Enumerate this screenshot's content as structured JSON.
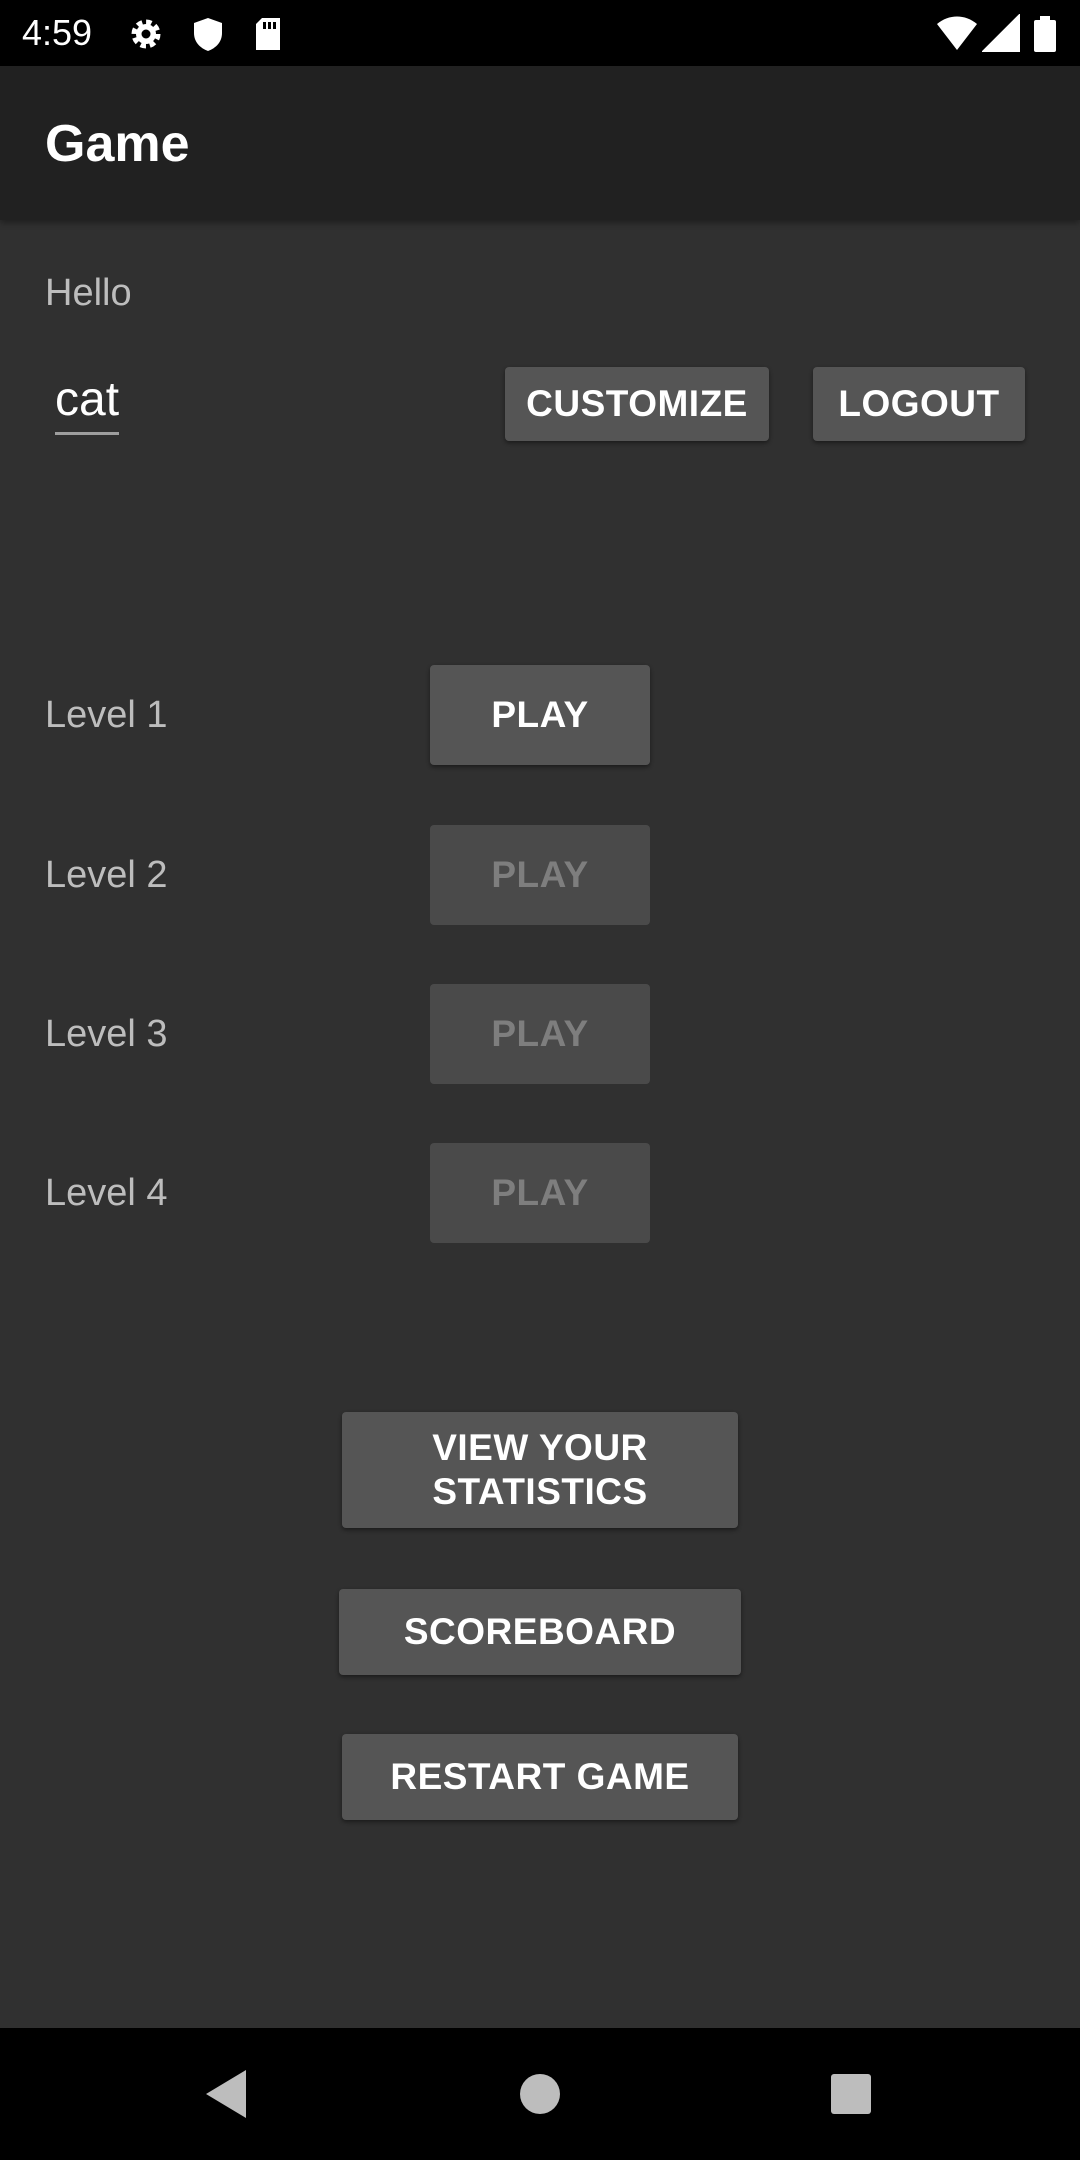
{
  "status_bar": {
    "time": "4:59",
    "icons": [
      "settings-icon",
      "shield-icon",
      "sd-card-icon",
      "wifi-icon",
      "signal-icon",
      "battery-icon"
    ]
  },
  "app_bar": {
    "title": "Game"
  },
  "greeting": {
    "hello": "Hello",
    "username": "cat"
  },
  "top_actions": {
    "customize": "CUSTOMIZE",
    "logout": "LOGOUT"
  },
  "levels": [
    {
      "label": "Level 1",
      "button": "PLAY",
      "enabled": true
    },
    {
      "label": "Level 2",
      "button": "PLAY",
      "enabled": false
    },
    {
      "label": "Level 3",
      "button": "PLAY",
      "enabled": false
    },
    {
      "label": "Level 4",
      "button": "PLAY",
      "enabled": false
    }
  ],
  "bottom_actions": {
    "statistics": "VIEW YOUR STATISTICS",
    "scoreboard": "SCOREBOARD",
    "restart": "RESTART GAME"
  },
  "nav_bar": {
    "icons": [
      "back-icon",
      "home-icon",
      "recents-icon"
    ]
  },
  "colors": {
    "background": "#303030",
    "app_bar": "#212121",
    "button": "#555555",
    "button_disabled": "#4a4a4a"
  }
}
